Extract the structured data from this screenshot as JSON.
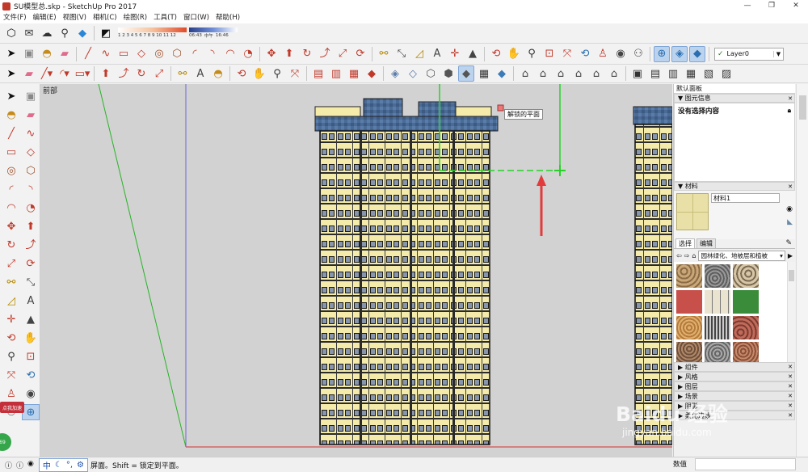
{
  "window": {
    "title": "SU模型总.skp - SketchUp Pro 2017",
    "controls": [
      "—",
      "❐",
      "✕"
    ]
  },
  "menu": [
    "文件(F)",
    "编辑(E)",
    "视图(V)",
    "相机(C)",
    "绘图(R)",
    "工具(T)",
    "窗口(W)",
    "帮助(H)"
  ],
  "shadow": {
    "months": "1 2 3 4 5 6 7 8 9 10 11 12",
    "time_start": "06:43",
    "time_mid": "中午",
    "time_end": "16:46"
  },
  "layer": {
    "value": "Layer0"
  },
  "viewport": {
    "view_name": "前部",
    "tooltip": "解锁的平面"
  },
  "panel": {
    "title": "默认面板",
    "entity_section": "图元信息",
    "entity_text": "没有选择内容",
    "materials_section": "材料",
    "material_name": "材料1",
    "tab_select": "选择",
    "tab_edit": "编辑",
    "collection": "园林绿化、地被层和植被",
    "collapsed": [
      "组件",
      "风格",
      "图层",
      "场景",
      "阴影",
      "柔化边线"
    ]
  },
  "status": {
    "hint": "屏面。Shift = 锁定到平面。",
    "measure_label": "数值",
    "ime": "中"
  },
  "badges": {
    "accel": "点我加速",
    "ball": "69"
  },
  "watermark": {
    "line1": "Baidu 经验",
    "line2": "jingyan.baidu.com"
  },
  "colors": {
    "building": "#f4ebab",
    "roof": "#4a6b96",
    "axis_green": "#27b327",
    "axis_red": "#d23030",
    "axis_blue": "#6a6ad8",
    "arrow": "#e23b3b"
  }
}
